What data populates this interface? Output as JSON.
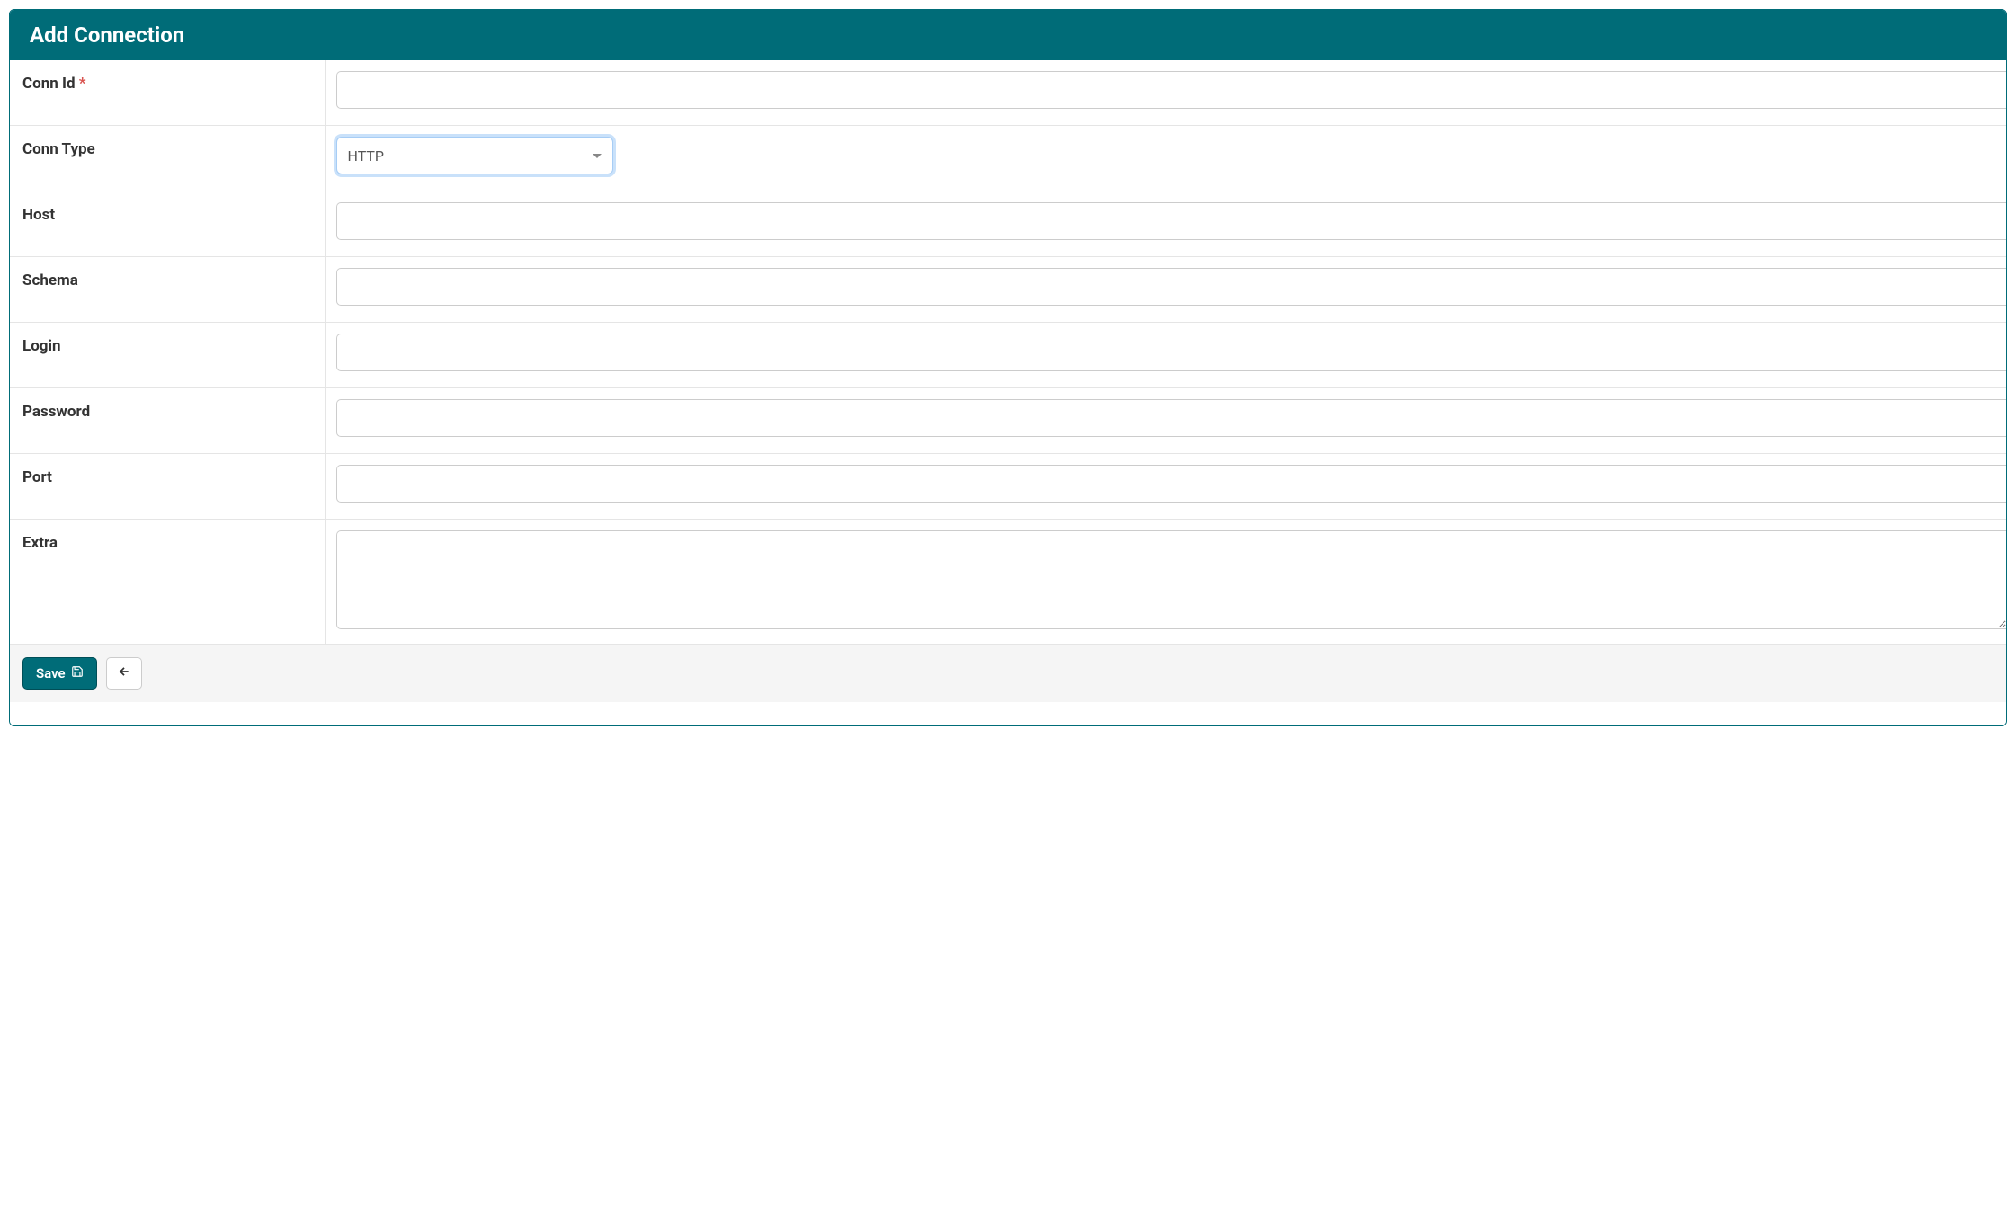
{
  "header": {
    "title": "Add Connection"
  },
  "form": {
    "conn_id": {
      "label": "Conn Id",
      "required_mark": "*",
      "value": ""
    },
    "conn_type": {
      "label": "Conn Type",
      "selected": "HTTP"
    },
    "host": {
      "label": "Host",
      "value": ""
    },
    "schema": {
      "label": "Schema",
      "value": ""
    },
    "login": {
      "label": "Login",
      "value": ""
    },
    "password": {
      "label": "Password",
      "value": ""
    },
    "port": {
      "label": "Port",
      "value": ""
    },
    "extra": {
      "label": "Extra",
      "value": ""
    }
  },
  "footer": {
    "save_label": "Save"
  }
}
